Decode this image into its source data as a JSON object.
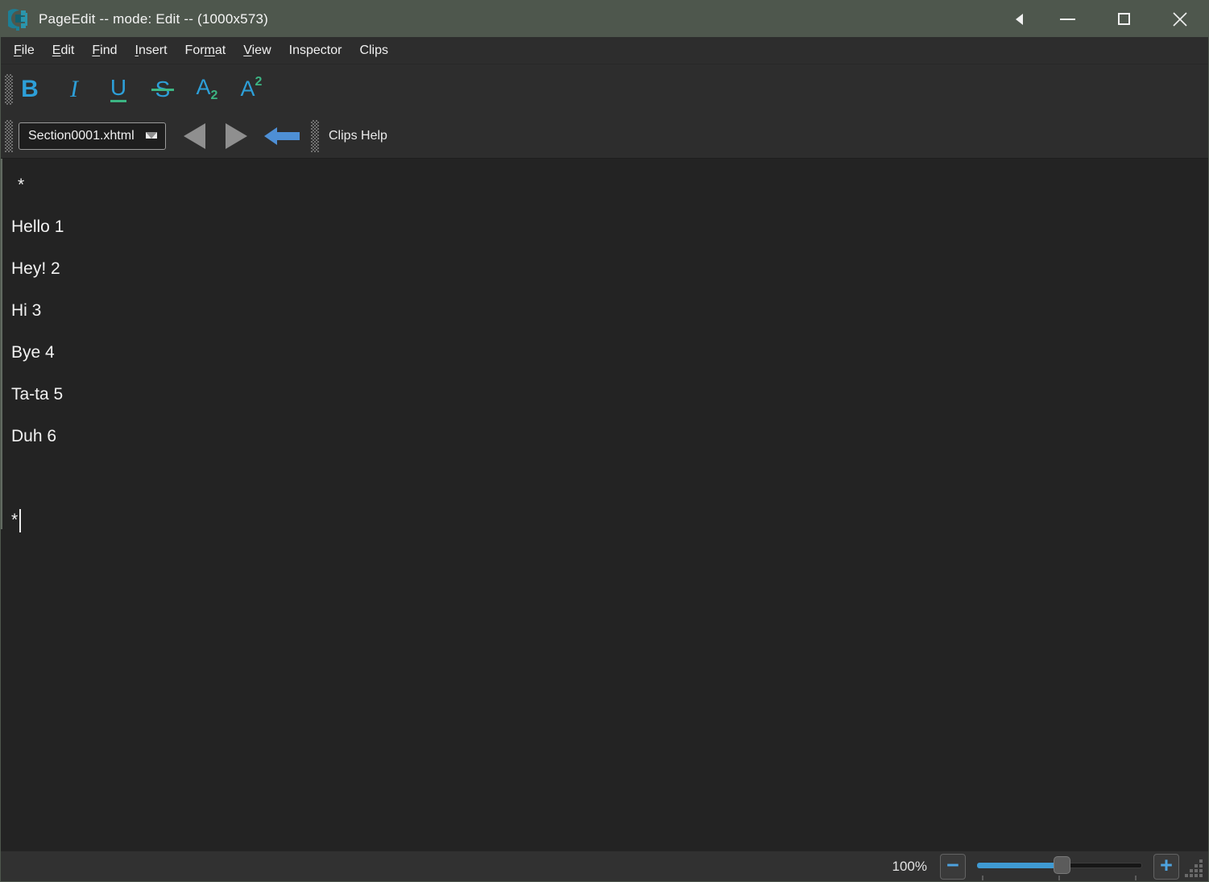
{
  "titlebar": {
    "title": "PageEdit -- mode: Edit -- (1000x573)"
  },
  "menubar": {
    "items": [
      {
        "pre": "",
        "key": "F",
        "post": "ile"
      },
      {
        "pre": "",
        "key": "E",
        "post": "dit"
      },
      {
        "pre": "",
        "key": "F",
        "post": "ind"
      },
      {
        "pre": "",
        "key": "I",
        "post": "nsert"
      },
      {
        "pre": "For",
        "key": "m",
        "post": "at"
      },
      {
        "pre": "",
        "key": "V",
        "post": "iew"
      },
      {
        "pre": "Inspector",
        "key": "",
        "post": ""
      },
      {
        "pre": "Clips",
        "key": "",
        "post": ""
      }
    ]
  },
  "format_toolbar": {
    "bold_label": "B",
    "italic_label": "I",
    "underline_label": "U",
    "strikethrough_label": "S",
    "subscript_base": "A",
    "subscript_mark": "2",
    "superscript_base": "A",
    "superscript_mark": "2"
  },
  "nav_toolbar": {
    "file_selector_value": "Section0001.xhtml",
    "clips_help_label": "Clips Help"
  },
  "editor": {
    "paragraphs": [
      "*",
      "Hello 1",
      "Hey! 2",
      "Hi 3",
      "Bye 4",
      "Ta-ta 5",
      "Duh 6",
      "*"
    ]
  },
  "statusbar": {
    "zoom_level": "100%"
  },
  "icons": {
    "minus_glyph": "−",
    "plus_glyph": "+"
  },
  "colors": {
    "titlebar_bg": "#4e574d",
    "toolbar_bg": "#2d2d2d",
    "content_bg": "#232323",
    "statusbar_bg": "#313131",
    "accent_blue": "#2d9fd8",
    "accent_green": "#3cb583",
    "nav_arrow_gray": "#8f8f8f",
    "back_arrow_blue": "#4e8fd5",
    "slider_fill_blue": "#3f9ad3"
  }
}
